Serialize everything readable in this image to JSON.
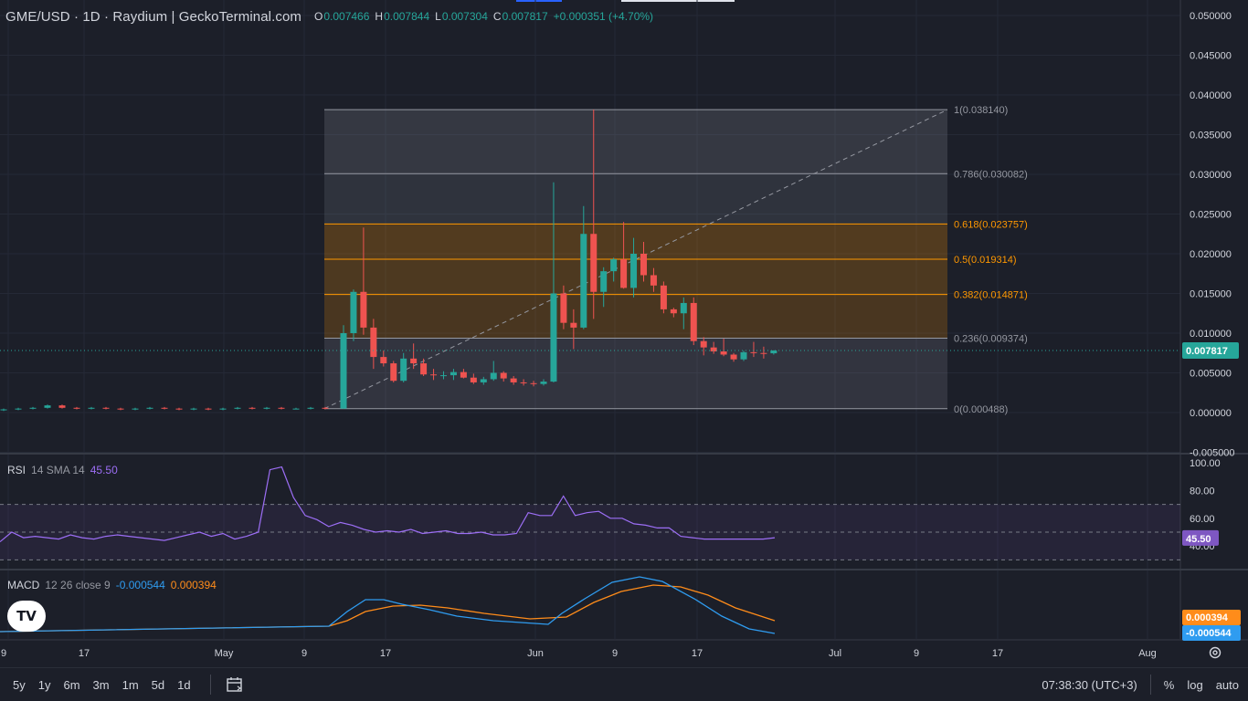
{
  "header": {
    "symbol": "GME/USD · 1D · Raydium  |  GeckoTerminal.com",
    "o_label": "O",
    "o_value": "0.007466",
    "h_label": "H",
    "h_value": "0.007844",
    "l_label": "L",
    "l_value": "0.007304",
    "c_label": "C",
    "c_value": "0.007817",
    "change": "+0.000351 (+4.70%)"
  },
  "price_axis": {
    "labels": [
      "0.050000",
      "0.045000",
      "0.040000",
      "0.035000",
      "0.030000",
      "0.025000",
      "0.020000",
      "0.015000",
      "0.010000",
      "0.005000",
      "0.000000",
      "-0.005000"
    ],
    "last_price": "0.007817"
  },
  "fib": {
    "levels": [
      {
        "ratio": "1",
        "price": 0.03814,
        "label": "1(0.038140)",
        "color": "#9598a1"
      },
      {
        "ratio": "0.786",
        "price": 0.030082,
        "label": "0.786(0.030082)",
        "color": "#9598a1"
      },
      {
        "ratio": "0.618",
        "price": 0.023757,
        "label": "0.618(0.023757)",
        "color": "#ff9800"
      },
      {
        "ratio": "0.5",
        "price": 0.019314,
        "label": "0.5(0.019314)",
        "color": "#ff9800"
      },
      {
        "ratio": "0.382",
        "price": 0.014871,
        "label": "0.382(0.014871)",
        "color": "#ff9800"
      },
      {
        "ratio": "0.236",
        "price": 0.009374,
        "label": "0.236(0.009374)",
        "color": "#9598a1"
      },
      {
        "ratio": "0",
        "price": 0.000488,
        "label": "0(0.000488)",
        "color": "#9598a1"
      }
    ]
  },
  "rsi": {
    "name": "RSI",
    "params": "14 SMA 14",
    "value": "45.50",
    "axis_labels": [
      "100.00",
      "80.00",
      "60.00",
      "40.00"
    ],
    "values": [
      43,
      50,
      46,
      47,
      46,
      45,
      48,
      46,
      45,
      47,
      48,
      47,
      46,
      45,
      44,
      46,
      48,
      50,
      47,
      49,
      45,
      47,
      50,
      95,
      97,
      75,
      62,
      59,
      54,
      57,
      55,
      52,
      50,
      51,
      50,
      52,
      49,
      50,
      51,
      49,
      49,
      50,
      48,
      48,
      49,
      64,
      62,
      62,
      76,
      62,
      64,
      65,
      60,
      60,
      56,
      55,
      53,
      53,
      47,
      46,
      45,
      45,
      45,
      45,
      45,
      45,
      46
    ]
  },
  "macd": {
    "name": "MACD",
    "params": "12 26 close 9",
    "macd_value": "-0.000544",
    "signal_value": "0.000394"
  },
  "x_axis": {
    "labels": [
      "9",
      "17",
      "May",
      "9",
      "17",
      "Jun",
      "9",
      "17",
      "Jul",
      "9",
      "17",
      "Aug"
    ]
  },
  "candles": [
    [
      0.0003,
      0.0005,
      0.0002,
      0.0004
    ],
    [
      0.0004,
      0.0006,
      0.0003,
      0.0005
    ],
    [
      0.0005,
      0.0007,
      0.0004,
      0.0006
    ],
    [
      0.0006,
      0.001,
      0.0005,
      0.0009
    ],
    [
      0.0009,
      0.001,
      0.0005,
      0.0006
    ],
    [
      0.0006,
      0.0007,
      0.0004,
      0.0005
    ],
    [
      0.0005,
      0.0007,
      0.0004,
      0.0006
    ],
    [
      0.0006,
      0.0007,
      0.0004,
      0.0005
    ],
    [
      0.0005,
      0.0006,
      0.0003,
      0.0004
    ],
    [
      0.0004,
      0.0006,
      0.0003,
      0.0005
    ],
    [
      0.0005,
      0.0007,
      0.0004,
      0.0006
    ],
    [
      0.0006,
      0.0007,
      0.0004,
      0.0005
    ],
    [
      0.0005,
      0.0006,
      0.0003,
      0.0004
    ],
    [
      0.0004,
      0.0006,
      0.0003,
      0.0005
    ],
    [
      0.0005,
      0.0006,
      0.0003,
      0.0004
    ],
    [
      0.0004,
      0.0006,
      0.0003,
      0.0005
    ],
    [
      0.0005,
      0.0007,
      0.0004,
      0.0006
    ],
    [
      0.0006,
      0.0007,
      0.0004,
      0.0005
    ],
    [
      0.0005,
      0.0007,
      0.0004,
      0.0006
    ],
    [
      0.0006,
      0.0007,
      0.0004,
      0.0005
    ],
    [
      0.0005,
      0.0006,
      0.0004,
      0.0005
    ],
    [
      0.0005,
      0.0007,
      0.0004,
      0.0006
    ],
    [
      0.0006,
      0.0007,
      0.0004,
      0.0005
    ],
    [
      0.0005,
      0.011,
      0.00048,
      0.01
    ],
    [
      0.01,
      0.0155,
      0.009,
      0.0152
    ],
    [
      0.0152,
      0.0233,
      0.0098,
      0.0107
    ],
    [
      0.0107,
      0.0118,
      0.0055,
      0.007
    ],
    [
      0.007,
      0.0078,
      0.0058,
      0.0062
    ],
    [
      0.0062,
      0.0065,
      0.0038,
      0.004
    ],
    [
      0.004,
      0.0075,
      0.0038,
      0.0068
    ],
    [
      0.0068,
      0.0087,
      0.0055,
      0.0062
    ],
    [
      0.0062,
      0.0068,
      0.0046,
      0.0048
    ],
    [
      0.0048,
      0.0055,
      0.0041,
      0.0047
    ],
    [
      0.0047,
      0.0052,
      0.0042,
      0.0047
    ],
    [
      0.0047,
      0.0055,
      0.0041,
      0.0051
    ],
    [
      0.0051,
      0.0055,
      0.0043,
      0.0044
    ],
    [
      0.0044,
      0.0049,
      0.0036,
      0.0038
    ],
    [
      0.0038,
      0.0045,
      0.0035,
      0.0042
    ],
    [
      0.0042,
      0.0065,
      0.004,
      0.005
    ],
    [
      0.005,
      0.0052,
      0.0039,
      0.0043
    ],
    [
      0.0043,
      0.0046,
      0.0035,
      0.0038
    ],
    [
      0.0038,
      0.0042,
      0.0034,
      0.0037
    ],
    [
      0.0037,
      0.004,
      0.0033,
      0.0036
    ],
    [
      0.0036,
      0.0042,
      0.0034,
      0.0039
    ],
    [
      0.0039,
      0.029,
      0.0038,
      0.015
    ],
    [
      0.015,
      0.016,
      0.0105,
      0.0113
    ],
    [
      0.0113,
      0.013,
      0.008,
      0.0107
    ],
    [
      0.0107,
      0.026,
      0.0105,
      0.0225
    ],
    [
      0.0225,
      0.03814,
      0.0118,
      0.0152
    ],
    [
      0.0152,
      0.0183,
      0.0133,
      0.0178
    ],
    [
      0.0178,
      0.0195,
      0.0165,
      0.0193
    ],
    [
      0.0193,
      0.024,
      0.0156,
      0.0157
    ],
    [
      0.0157,
      0.022,
      0.0145,
      0.02
    ],
    [
      0.02,
      0.0215,
      0.0165,
      0.0173
    ],
    [
      0.0173,
      0.0182,
      0.0152,
      0.016
    ],
    [
      0.016,
      0.0165,
      0.0125,
      0.013
    ],
    [
      0.013,
      0.0132,
      0.012,
      0.0125
    ],
    [
      0.0125,
      0.0145,
      0.0105,
      0.0138
    ],
    [
      0.0138,
      0.0145,
      0.0085,
      0.009
    ],
    [
      0.009,
      0.0095,
      0.0072,
      0.0082
    ],
    [
      0.0082,
      0.0089,
      0.0074,
      0.0077
    ],
    [
      0.0077,
      0.0093,
      0.0071,
      0.0073
    ],
    [
      0.0073,
      0.0075,
      0.0064,
      0.0067
    ],
    [
      0.0067,
      0.0078,
      0.0065,
      0.0076
    ],
    [
      0.0076,
      0.0089,
      0.007,
      0.0075
    ],
    [
      0.0075,
      0.0083,
      0.0068,
      0.007466
    ],
    [
      0.007466,
      0.007844,
      0.007304,
      0.007817
    ]
  ],
  "toolbar": {
    "ranges": [
      "5y",
      "1y",
      "6m",
      "3m",
      "1m",
      "5d",
      "1d"
    ],
    "clock": "07:38:30 (UTC+3)",
    "percent": "%",
    "log": "log",
    "auto": "auto"
  }
}
